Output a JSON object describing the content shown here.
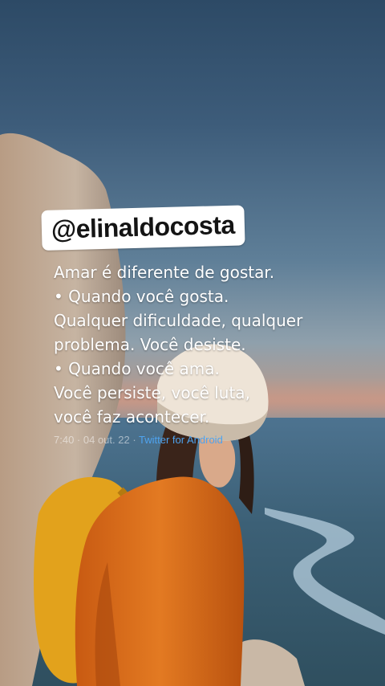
{
  "tweet": {
    "handle": "@elinaldocosta",
    "lines": [
      "Amar é diferente de gostar.",
      "• Quando você gosta.",
      "Qualquer dificuldade, qualquer",
      "problema. Você desiste.",
      "• Quando você ama.",
      "Você persiste, você luta,",
      "você faz acontecer."
    ],
    "time": "7:40",
    "separator": " · ",
    "date": "04 out. 22",
    "source": "Twitter for Android"
  },
  "colors": {
    "source_link": "#4ea3ef",
    "jacket": "#e0741c",
    "backpack": "#e2a21c",
    "sky_top": "#2d4a66"
  }
}
